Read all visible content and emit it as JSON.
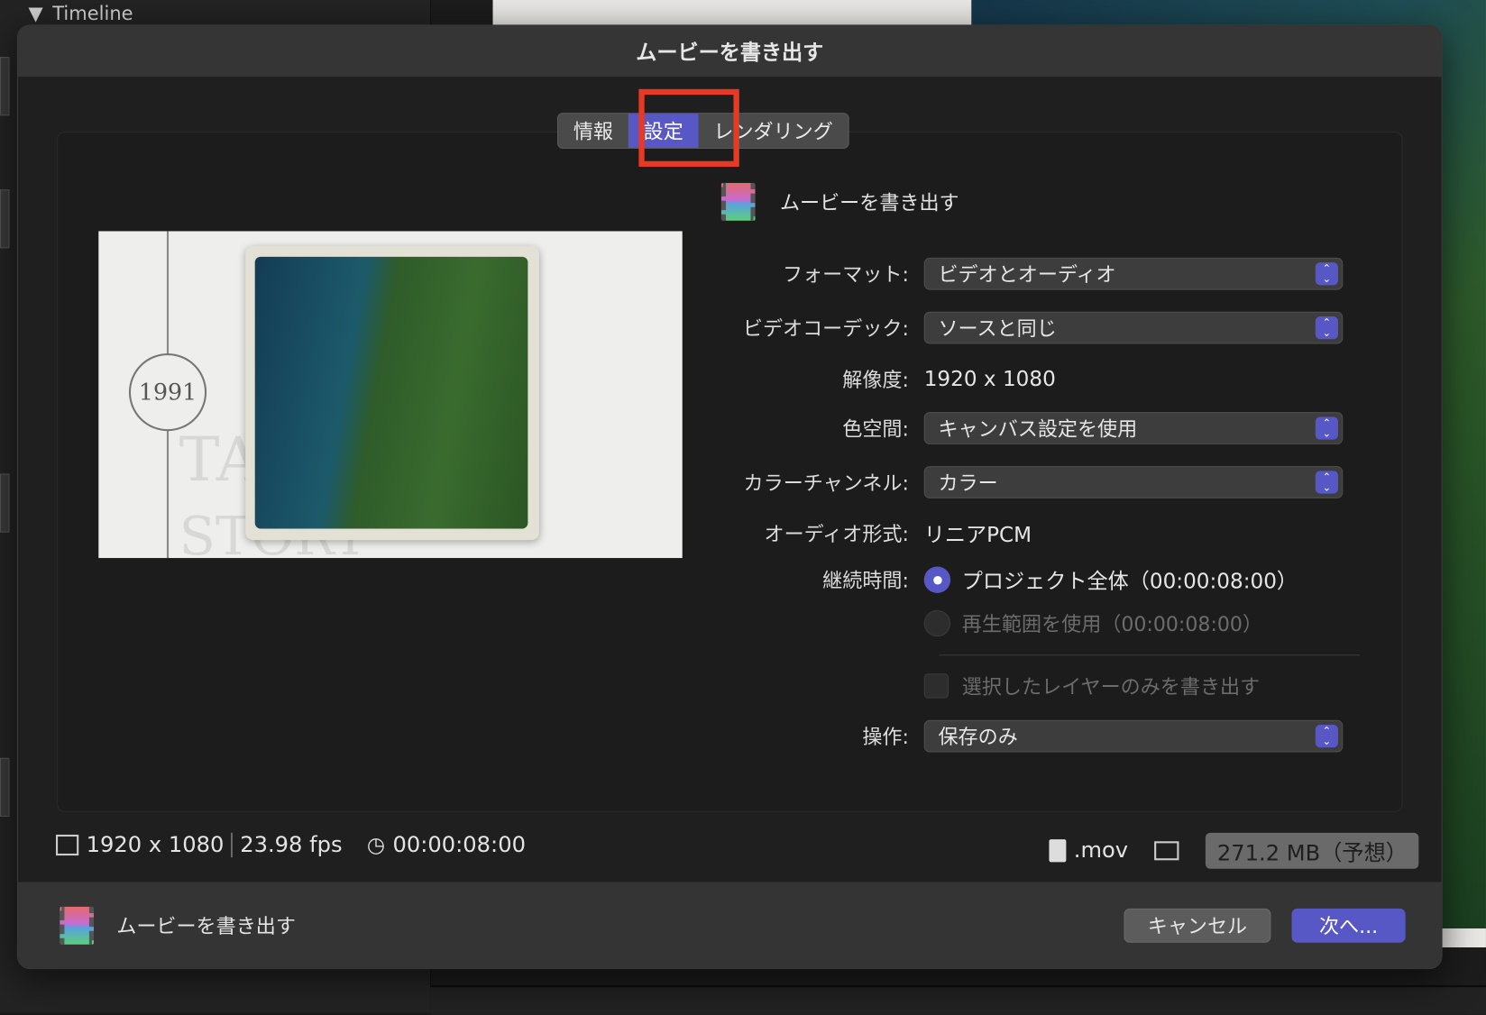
{
  "background": {
    "timeline_label": "Timeline"
  },
  "dialog": {
    "title": "ムービーを書き出す",
    "tabs": [
      {
        "label": "情報"
      },
      {
        "label": "設定"
      },
      {
        "label": "レンダリング"
      }
    ],
    "header": "ムービーを書き出す",
    "preview": {
      "year": "1991",
      "text1": "TA",
      "text2": "STORY"
    },
    "fields": {
      "format": {
        "label": "フォーマット:",
        "value": "ビデオとオーディオ"
      },
      "codec": {
        "label": "ビデオコーデック:",
        "value": "ソースと同じ"
      },
      "resolution": {
        "label": "解像度:",
        "value": "1920 x 1080"
      },
      "colorspace": {
        "label": "色空間:",
        "value": "キャンバス設定を使用"
      },
      "channels": {
        "label": "カラーチャンネル:",
        "value": "カラー"
      },
      "audio": {
        "label": "オーディオ形式:",
        "value": "リニアPCM"
      },
      "duration": {
        "label": "継続時間:",
        "option1": "プロジェクト全体（00:00:08:00）",
        "option2": "再生範囲を使用（00:00:08:00）"
      },
      "layers_only": "選択したレイヤーのみを書き出す",
      "action": {
        "label": "操作:",
        "value": "保存のみ"
      }
    },
    "info": {
      "resolution": "1920 x 1080",
      "fps": "23.98 fps",
      "duration": "00:00:08:00",
      "ext": ".mov",
      "size": "271.2 MB（予想）"
    },
    "footer": {
      "title": "ムービーを書き出す",
      "cancel": "キャンセル",
      "next": "次へ..."
    }
  }
}
